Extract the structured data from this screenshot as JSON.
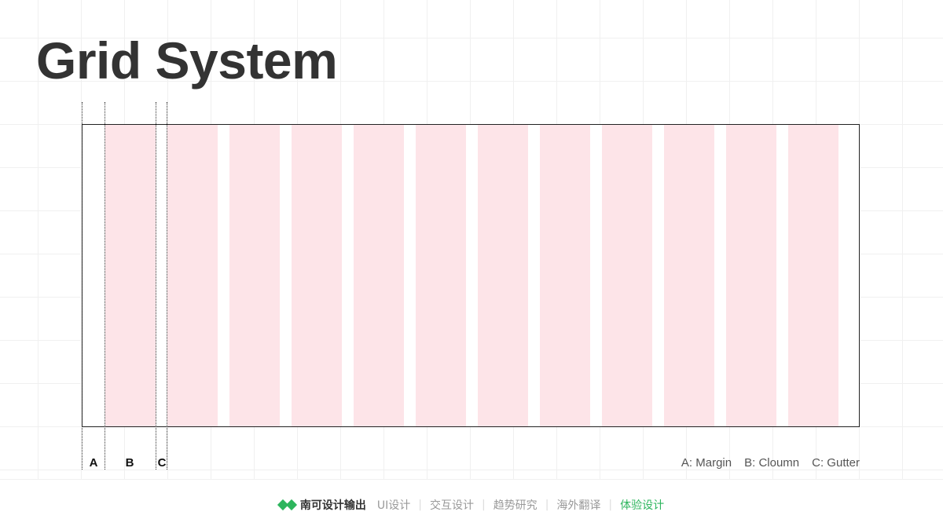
{
  "title": "Grid System",
  "grid": {
    "column_count": 12
  },
  "labels": {
    "a": "A",
    "b": "B",
    "c": "C"
  },
  "legend": {
    "a": "A: Margin",
    "b": "B: Cloumn",
    "c": "C: Gutter"
  },
  "footer": {
    "brand": "南可设计输出",
    "nav": [
      {
        "label": "UI设计",
        "active": false
      },
      {
        "label": "交互设计",
        "active": false
      },
      {
        "label": "趋势研究",
        "active": false
      },
      {
        "label": "海外翻译",
        "active": false
      },
      {
        "label": "体验设计",
        "active": true
      }
    ]
  },
  "colors": {
    "column": "#fde4e8",
    "accent": "#2db55d",
    "title": "#333333"
  }
}
